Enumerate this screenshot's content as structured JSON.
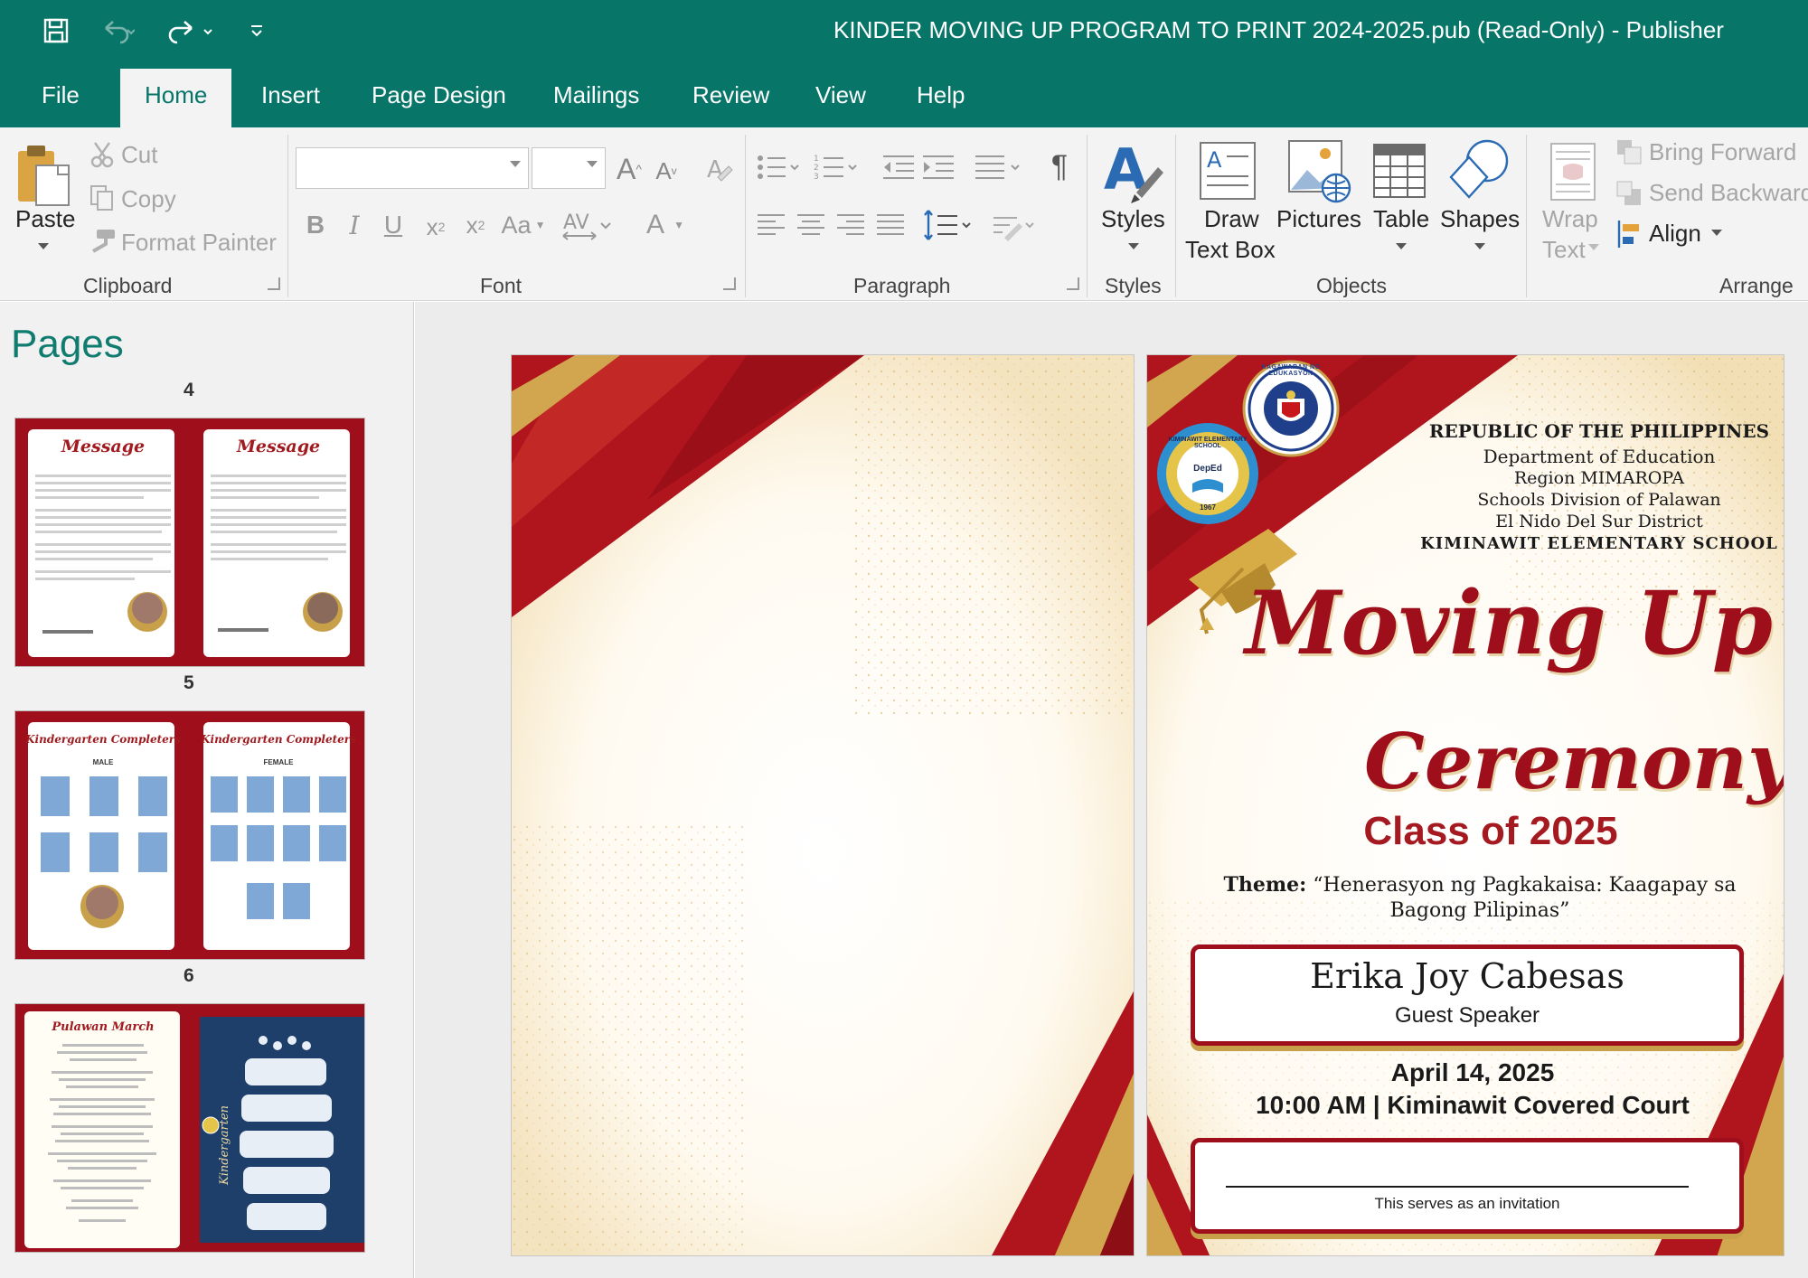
{
  "window": {
    "title": "KINDER MOVING UP PROGRAM TO PRINT 2024-2025.pub (Read-Only)  -  Publisher"
  },
  "tabs": [
    "File",
    "Home",
    "Insert",
    "Page Design",
    "Mailings",
    "Review",
    "View",
    "Help"
  ],
  "active_tab": "Home",
  "ribbon": {
    "clipboard": {
      "paste": "Paste",
      "cut": "Cut",
      "copy": "Copy",
      "format_painter": "Format Painter",
      "label": "Clipboard"
    },
    "font": {
      "label": "Font",
      "font_name": "",
      "font_size": "",
      "change_case": "Aa"
    },
    "paragraph": {
      "label": "Paragraph"
    },
    "styles": {
      "button": "Styles",
      "label": "Styles"
    },
    "objects": {
      "draw_text_box_1": "Draw",
      "draw_text_box_2": "Text Box",
      "pictures": "Pictures",
      "table": "Table",
      "shapes": "Shapes",
      "label": "Objects"
    },
    "arrange": {
      "wrap_text_1": "Wrap",
      "wrap_text_2": "Text",
      "bring_forward": "Bring Forward",
      "send_backward": "Send Backward",
      "align": "Align",
      "label": "Arrange"
    }
  },
  "pages_pane": {
    "title": "Pages",
    "page_numbers": [
      "4",
      "5",
      "6"
    ],
    "thumbs": {
      "p4_left_title": "Message",
      "p4_right_title": "Message",
      "p5_left_title": "Kindergarten Completers",
      "p5_left_sub": "MALE",
      "p5_right_title": "Kindergarten Completers",
      "p5_right_sub": "FEMALE",
      "p6_left_title": "Pulawan March",
      "p6_right_title": "Kindergarten"
    }
  },
  "document": {
    "header": {
      "republic": "REPUBLIC OF THE PHILIPPINES",
      "deped": "Department of Education",
      "region": "Region MIMAROPA",
      "division": "Schools Division of Palawan",
      "district": "El Nido Del Sur District",
      "school": "KIMINAWIT ELEMENTARY SCHOOL"
    },
    "seals": {
      "deped_seal_text": "KAGAWARAN NG EDUKASYON",
      "school_seal_text": "KIMINAWIT ELEMENTARY SCHOOL",
      "school_seal_center": "DepEd",
      "school_seal_year": "1967"
    },
    "title_moving": "Moving Up",
    "title_ceremony": "Ceremony",
    "class_of": "Class of 2025",
    "theme_label": "Theme:",
    "theme_text": "“Henerasyon ng Pagkakaisa: Kaagapay sa Bagong Pilipinas”",
    "speaker_name": "Erika Joy Cabesas",
    "speaker_role": "Guest Speaker",
    "date": "April 14, 2025",
    "time_place": "10:00 AM | Kiminawit Covered Court",
    "invitation": "This serves as an invitation"
  },
  "colors": {
    "app_green": "#077568",
    "maroon": "#9e0f1b",
    "red": "#c8161d",
    "gold": "#c9a04a"
  }
}
